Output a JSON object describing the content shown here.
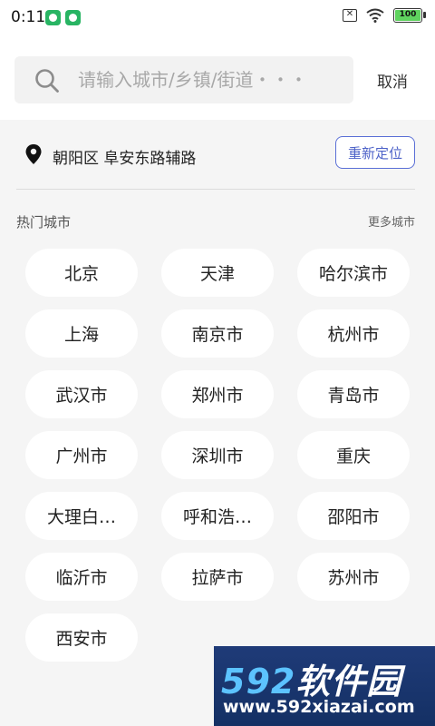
{
  "status_bar": {
    "time": "0:11",
    "sim_label": "✕",
    "battery_level": "100"
  },
  "search": {
    "placeholder": "请输入城市/乡镇/街道・・・",
    "cancel_label": "取消"
  },
  "location": {
    "current": "朝阳区 阜安东路辅路",
    "relocate_label": "重新定位"
  },
  "hot_cities": {
    "title": "热门城市",
    "more_label": "更多城市",
    "items": [
      "北京",
      "天津",
      "哈尔滨市",
      "上海",
      "南京市",
      "杭州市",
      "武汉市",
      "郑州市",
      "青岛市",
      "广州市",
      "深圳市",
      "重庆",
      "大理白…",
      "呼和浩…",
      "邵阳市",
      "临沂市",
      "拉萨市",
      "苏州市",
      "西安市"
    ]
  },
  "watermark": {
    "brand_num": "592",
    "brand_text": "软件园",
    "url": "www.592xiazai.com"
  },
  "colors": {
    "accent": "#4d62c8",
    "background": "#f5f5f5",
    "pill": "#ffffff"
  }
}
